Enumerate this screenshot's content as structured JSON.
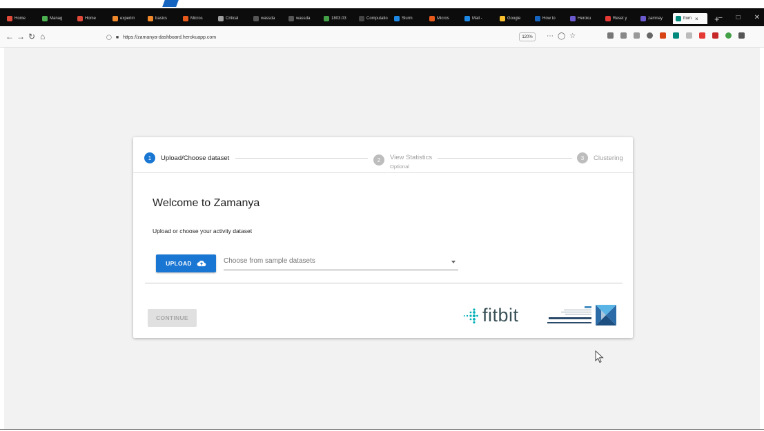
{
  "browser": {
    "tabs": [
      {
        "label": "Home",
        "color": "#e04a3a"
      },
      {
        "label": "Manag",
        "color": "#4caf50"
      },
      {
        "label": "Home",
        "color": "#e04a3a"
      },
      {
        "label": "experim",
        "color": "#f0892c"
      },
      {
        "label": "basics",
        "color": "#f0892c"
      },
      {
        "label": "Micros",
        "color": "#e85a1c"
      },
      {
        "label": "Critical",
        "color": "#9e9e9e"
      },
      {
        "label": "wassda",
        "color": "#555555"
      },
      {
        "label": "wassda",
        "color": "#555555"
      },
      {
        "label": "1803.03",
        "color": "#43a047"
      },
      {
        "label": "Computatio",
        "color": "#444444"
      },
      {
        "label": "Slurm",
        "color": "#1e88e5"
      },
      {
        "label": "Micros",
        "color": "#e85a1c"
      },
      {
        "label": "Mail -",
        "color": "#1e88e5"
      },
      {
        "label": "Google",
        "color": "#fbc02d"
      },
      {
        "label": "How to",
        "color": "#1565c0"
      },
      {
        "label": "Heroku",
        "color": "#6a5acd"
      },
      {
        "label": "Reset y",
        "color": "#e53935"
      },
      {
        "label": "zamnay",
        "color": "#6a5acd"
      },
      {
        "label": "from",
        "color": "#00897b",
        "active": true
      }
    ],
    "url": "https://zamanya-dashboard.herokuapp.com",
    "zoom": "120%"
  },
  "stepper": {
    "step1": {
      "num": "1",
      "label": "Upload/Choose dataset"
    },
    "step2": {
      "num": "2",
      "label": "View Statistics",
      "sub": "Optional"
    },
    "step3": {
      "num": "3",
      "label": "Clustering"
    }
  },
  "main": {
    "title": "Welcome to Zamanya",
    "subtitle": "Upload or choose your activity dataset",
    "upload_label": "UPLOAD",
    "select_placeholder": "Choose from sample datasets",
    "continue_label": "CONTINUE"
  },
  "logos": {
    "fitbit": "fitbit"
  },
  "colors": {
    "primary": "#1976d2",
    "fitbit": "#00b0b9",
    "step_active": "#1976d2",
    "step_inactive": "#9e9e9e"
  }
}
